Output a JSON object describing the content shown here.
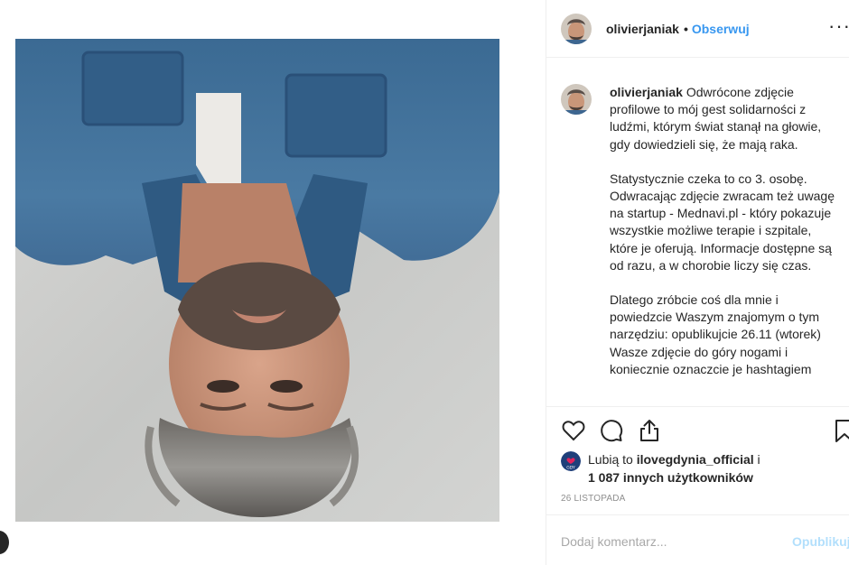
{
  "post": {
    "username": "olivierjaniak",
    "separator": "•",
    "follow_label": "Obserwuj",
    "more_label": "···"
  },
  "caption": {
    "username": "olivierjaniak",
    "paragraph1": "Odwrócone zdjęcie profilowe to mój gest solidarności z ludźmi, którym świat stanął na głowie, gdy dowiedzieli się, że mają raka.",
    "paragraph2": "Statystycznie czeka to co 3. osobę. Odwracając zdjęcie zwracam też uwagę na startup - Mednavi.pl - który pokazuje wszystkie możliwe terapie i szpitale, które je oferują. Informacje dostępne są od razu, a w chorobie liczy się czas.",
    "paragraph3": "Dlatego zróbcie coś dla mnie i powiedzcie Waszym znajomym o tym narzędziu: opublikujcie 26.11 (wtorek) Wasze zdjęcie do góry nogami i koniecznie oznaczcie je hashtagiem"
  },
  "actions": {
    "like_icon": "heart-icon",
    "comment_icon": "comment-icon",
    "share_icon": "share-icon",
    "save_icon": "bookmark-icon"
  },
  "likes": {
    "prefix": "Lubią to ",
    "liker": "ilovegdynia_official",
    "connector": " i",
    "others": "1 087 innych użytkowników",
    "liker_avatar_text": "GDY"
  },
  "timestamp": "26 LISTOPADA",
  "comment": {
    "placeholder": "Dodaj komentarz...",
    "publish_label": "Opublikuj"
  },
  "colors": {
    "link": "#3897f0",
    "publish_disabled": "#b2dffc",
    "muted": "#8e8e8e",
    "border": "#efefef"
  }
}
